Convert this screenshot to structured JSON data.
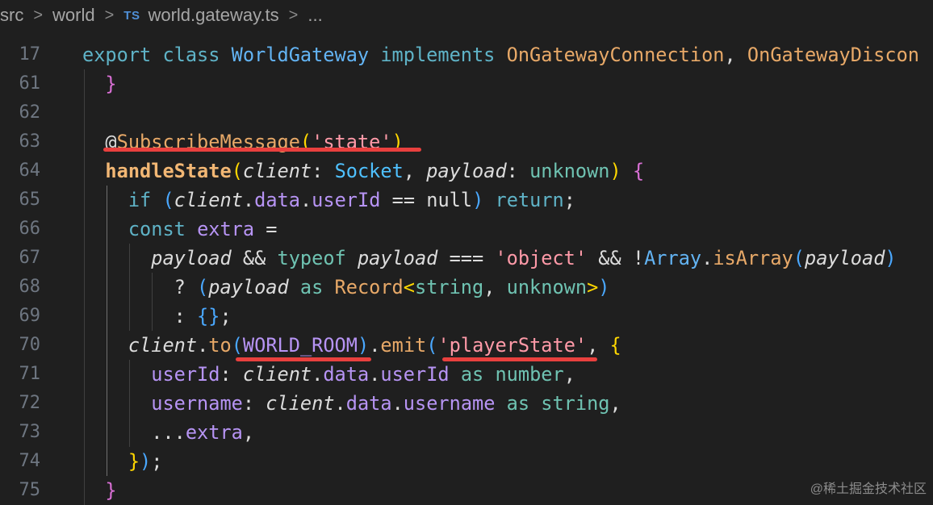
{
  "breadcrumb": {
    "items": [
      "src",
      "world",
      "world.gateway.ts",
      "..."
    ],
    "ts_badge": "TS",
    "separator": ">"
  },
  "editor": {
    "lines": [
      {
        "num": "17",
        "tokens": [
          [
            "kw",
            "export "
          ],
          [
            "kw",
            "class "
          ],
          [
            "class",
            "WorldGateway "
          ],
          [
            "kw",
            "implements "
          ],
          [
            "type",
            "OnGatewayConnection"
          ],
          [
            "plain",
            ", "
          ],
          [
            "type",
            "OnGatewayDiscon"
          ]
        ]
      },
      {
        "num": "61",
        "tokens": [
          [
            "plain",
            "  "
          ],
          [
            "p2",
            "}"
          ]
        ]
      },
      {
        "num": "62",
        "tokens": []
      },
      {
        "num": "63",
        "tokens": [
          [
            "plain",
            "  @"
          ],
          [
            "fn",
            "SubscribeMessage"
          ],
          [
            "p1",
            "("
          ],
          [
            "str",
            "'state'"
          ],
          [
            "p1",
            ")"
          ]
        ]
      },
      {
        "num": "64",
        "tokens": [
          [
            "plain",
            "  "
          ],
          [
            "fnb",
            "handleState"
          ],
          [
            "p1",
            "("
          ],
          [
            "param",
            "client"
          ],
          [
            "plain",
            ": "
          ],
          [
            "typeb",
            "Socket"
          ],
          [
            "plain",
            ", "
          ],
          [
            "param",
            "payload"
          ],
          [
            "plain",
            ": "
          ],
          [
            "kwgreen",
            "unknown"
          ],
          [
            "p1",
            ")"
          ],
          [
            "plain",
            " "
          ],
          [
            "p2",
            "{"
          ]
        ]
      },
      {
        "num": "65",
        "tokens": [
          [
            "plain",
            "    "
          ],
          [
            "ctrl",
            "if "
          ],
          [
            "p3",
            "("
          ],
          [
            "param",
            "client"
          ],
          [
            "plain",
            "."
          ],
          [
            "prop",
            "data"
          ],
          [
            "plain",
            "."
          ],
          [
            "prop",
            "userId"
          ],
          [
            "plain",
            " == "
          ],
          [
            "plain",
            "null"
          ],
          [
            "p3",
            ")"
          ],
          [
            "plain",
            " "
          ],
          [
            "ctrl",
            "return"
          ],
          [
            "plain",
            ";"
          ]
        ]
      },
      {
        "num": "66",
        "tokens": [
          [
            "plain",
            "    "
          ],
          [
            "kw",
            "const "
          ],
          [
            "const",
            "extra "
          ],
          [
            "plain",
            "="
          ]
        ]
      },
      {
        "num": "67",
        "tokens": [
          [
            "plain",
            "      "
          ],
          [
            "param",
            "payload "
          ],
          [
            "plain",
            "&& "
          ],
          [
            "kwgreen",
            "typeof "
          ],
          [
            "param",
            "payload "
          ],
          [
            "plain",
            "=== "
          ],
          [
            "str",
            "'object' "
          ],
          [
            "plain",
            "&& !"
          ],
          [
            "class",
            "Array"
          ],
          [
            "plain",
            "."
          ],
          [
            "fn",
            "isArray"
          ],
          [
            "p3",
            "("
          ],
          [
            "param",
            "payload"
          ],
          [
            "p3",
            ")"
          ]
        ]
      },
      {
        "num": "68",
        "tokens": [
          [
            "plain",
            "        ? "
          ],
          [
            "p3",
            "("
          ],
          [
            "param",
            "payload "
          ],
          [
            "kwgreen",
            "as "
          ],
          [
            "type",
            "Record"
          ],
          [
            "p1",
            "<"
          ],
          [
            "kwgreen",
            "string"
          ],
          [
            "plain",
            ", "
          ],
          [
            "kwgreen",
            "unknown"
          ],
          [
            "p1",
            ">"
          ],
          [
            "p3",
            ")"
          ]
        ]
      },
      {
        "num": "69",
        "tokens": [
          [
            "plain",
            "        : "
          ],
          [
            "p3",
            "{}"
          ],
          [
            "plain",
            ";"
          ]
        ]
      },
      {
        "num": "70",
        "tokens": [
          [
            "plain",
            "    "
          ],
          [
            "param",
            "client"
          ],
          [
            "plain",
            "."
          ],
          [
            "fn",
            "to"
          ],
          [
            "p3",
            "("
          ],
          [
            "const",
            "WORLD_ROOM"
          ],
          [
            "p3",
            ")"
          ],
          [
            "plain",
            "."
          ],
          [
            "fn",
            "emit"
          ],
          [
            "p3",
            "("
          ],
          [
            "str",
            "'playerState'"
          ],
          [
            "plain",
            ", "
          ],
          [
            "p1",
            "{"
          ]
        ]
      },
      {
        "num": "71",
        "tokens": [
          [
            "plain",
            "      "
          ],
          [
            "prop",
            "userId"
          ],
          [
            "plain",
            ": "
          ],
          [
            "param",
            "client"
          ],
          [
            "plain",
            "."
          ],
          [
            "prop",
            "data"
          ],
          [
            "plain",
            "."
          ],
          [
            "prop",
            "userId "
          ],
          [
            "kwgreen",
            "as "
          ],
          [
            "kwgreen",
            "number"
          ],
          [
            "plain",
            ","
          ]
        ]
      },
      {
        "num": "72",
        "tokens": [
          [
            "plain",
            "      "
          ],
          [
            "prop",
            "username"
          ],
          [
            "plain",
            ": "
          ],
          [
            "param",
            "client"
          ],
          [
            "plain",
            "."
          ],
          [
            "prop",
            "data"
          ],
          [
            "plain",
            "."
          ],
          [
            "prop",
            "username "
          ],
          [
            "kwgreen",
            "as "
          ],
          [
            "kwgreen",
            "string"
          ],
          [
            "plain",
            ","
          ]
        ]
      },
      {
        "num": "73",
        "tokens": [
          [
            "plain",
            "      ..."
          ],
          [
            "const",
            "extra"
          ],
          [
            "plain",
            ","
          ]
        ]
      },
      {
        "num": "74",
        "tokens": [
          [
            "plain",
            "    "
          ],
          [
            "p1",
            "}"
          ],
          [
            "p3",
            ")"
          ],
          [
            "plain",
            ";"
          ]
        ]
      },
      {
        "num": "75",
        "tokens": [
          [
            "plain",
            "  "
          ],
          [
            "p2",
            "}"
          ]
        ]
      }
    ]
  },
  "watermark": "@稀土掘金技术社区",
  "colors": {
    "background": "#1f1f1f",
    "underline": "#e8403e",
    "line_number": "#6e7681"
  }
}
